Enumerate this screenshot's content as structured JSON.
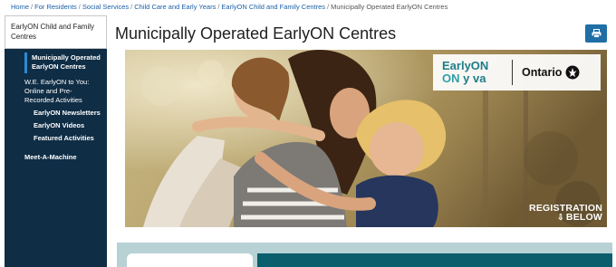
{
  "breadcrumb": {
    "items": [
      "Home",
      "For Residents",
      "Social Services",
      "Child Care and Early Years",
      "EarlyON Child and Family Centres"
    ],
    "current": "Municipally Operated EarlyON Centres",
    "separator": "/"
  },
  "sidebar": {
    "section_title": "EarlyON Child and Family Centres",
    "items": [
      {
        "label": "Municipally Operated EarlyON Centres",
        "active": true
      },
      {
        "label": "W.E. EarlyON to You: Online and Pre-Recorded Activities"
      },
      {
        "label": "EarlyON Newsletters"
      },
      {
        "label": "EarlyON Videos"
      },
      {
        "label": "Featured Activities"
      },
      {
        "label": "Meet-A-Machine"
      }
    ]
  },
  "page": {
    "title": "Municipally Operated EarlyON Centres",
    "print_icon": "print-icon"
  },
  "hero": {
    "logo_line1": "EarlyON",
    "logo_line2_a": "ON",
    "logo_line2_b": "y va",
    "ontario_label": "Ontario",
    "registration_line1": "REGISTRATION",
    "registration_line2": "BELOW",
    "arrow": "⇩"
  },
  "colors": {
    "sidebar_bg": "#0f2d45",
    "accent_blue": "#1f6fa6",
    "link_blue": "#1a5fa8",
    "teal": "#0b5e6b",
    "panel_bg": "#b7d1d4"
  }
}
